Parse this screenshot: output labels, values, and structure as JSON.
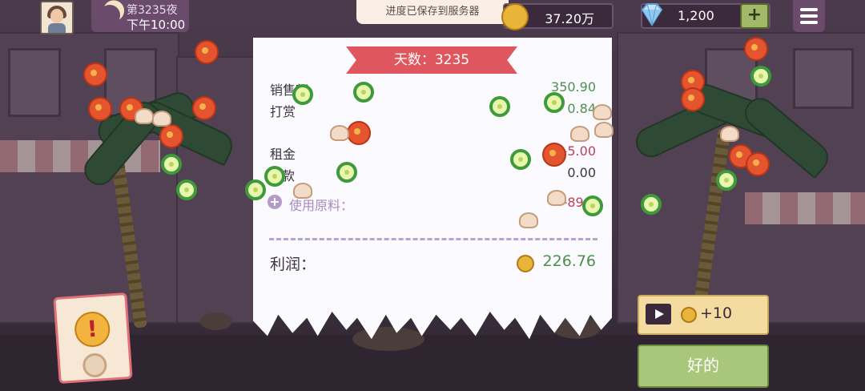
{
  "hud": {
    "day_label": "第3235夜",
    "time_label": "下午10:00",
    "toast": "进度已保存到服务器",
    "coins": "37.20万",
    "gems": "1,200",
    "add_gems": "+"
  },
  "receipt": {
    "day_banner": "天数：3235",
    "rows": [
      {
        "label": "销售额",
        "value": "350.90",
        "color": "#4e8f4e"
      },
      {
        "label": "打赏",
        "value": "0.84",
        "color": "#4e8f4e"
      },
      {
        "label": "租金",
        "value": "-5.00",
        "color": "#c0405a"
      },
      {
        "label": "款",
        "value": "0.00",
        "color": "#3d3340"
      }
    ],
    "materials_label": "使用原料：",
    "materials_value": "-89.9",
    "profit_label": "利润：",
    "profit_value": "226.76"
  },
  "buttons": {
    "ad_reward": "+10",
    "ok": "好的"
  },
  "alert": {
    "mark": "!"
  },
  "icons": [
    "moon-icon",
    "coin-icon",
    "diamond-icon",
    "menu-icon",
    "play-icon",
    "alert-icon"
  ]
}
